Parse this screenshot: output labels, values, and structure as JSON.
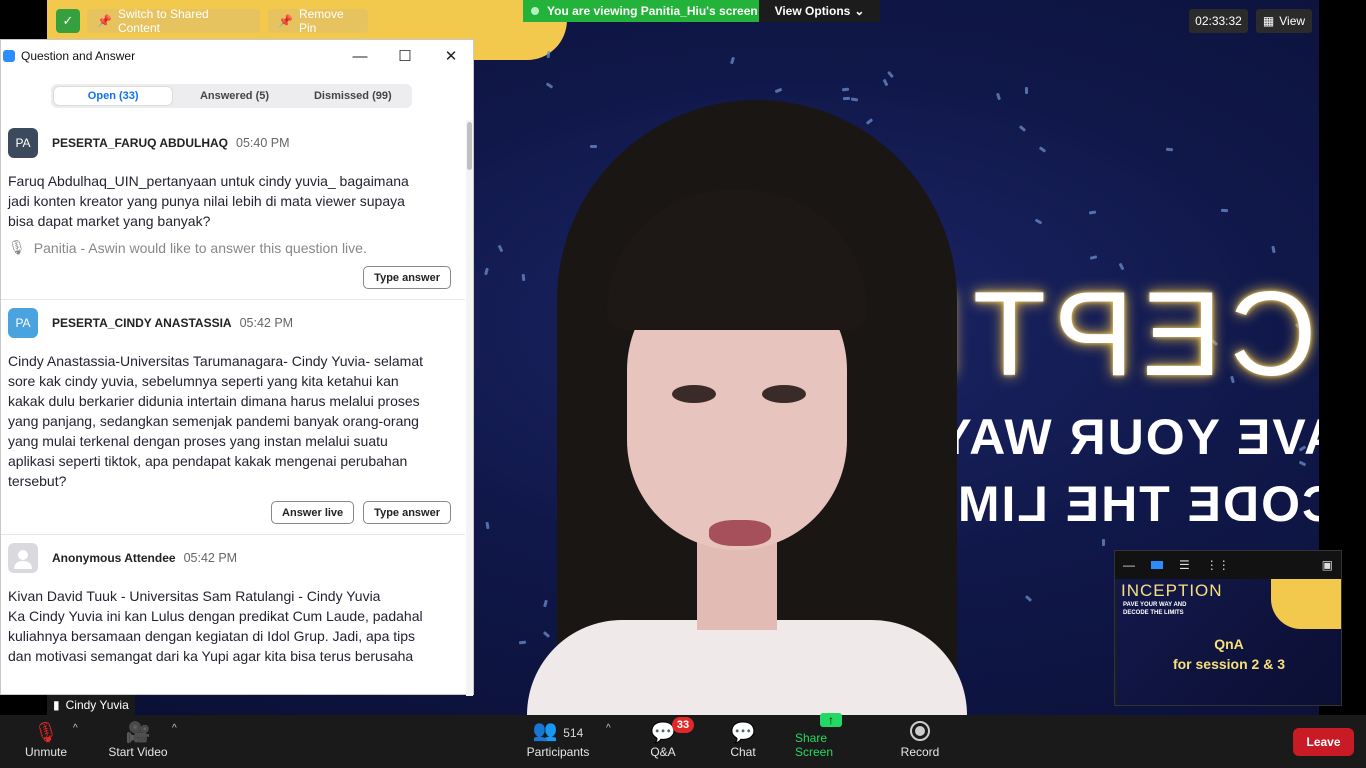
{
  "top_bar": {
    "switch_label": "Switch to Shared Content",
    "remove_pin_label": "Remove Pin",
    "viewing_label": "You are viewing Panitia_Hiu's screen",
    "view_options_label": "View Options",
    "timer": "02:33:32",
    "view_label": "View"
  },
  "video": {
    "inception_text": "INCEPTIO",
    "pave_text": "PAVE YOUR WAY AN",
    "decode_text": "DECODE THE LIMITS",
    "speaker_name": "Cindy Yuvia"
  },
  "qa_window": {
    "title": "Question and Answer",
    "tabs": [
      {
        "label": "Open (33)",
        "active": true
      },
      {
        "label": "Answered (5)",
        "active": false
      },
      {
        "label": "Dismissed (99)",
        "active": false
      }
    ],
    "questions": [
      {
        "avatar": "PA",
        "avatar_color": "#3b4a5c",
        "name": "PESERTA_FARUQ ABDULHAQ",
        "time": "05:40 PM",
        "text": "Faruq Abdulhaq_UIN_pertanyaan untuk cindy yuvia_ bagaimana\n jadi konten kreator yang punya nilai lebih di mata viewer supaya\nbisa dapat market yang banyak?",
        "live_note": "Panitia - Aswin would like to answer this question live.",
        "buttons": [
          "Type answer"
        ]
      },
      {
        "avatar": "PA",
        "avatar_color": "#4aa3df",
        "name": "PESERTA_CINDY ANASTASSIA",
        "time": "05:42 PM",
        "text": "Cindy Anastassia-Universitas Tarumanagara- Cindy Yuvia- selamat\nsore kak cindy yuvia, sebelumnya seperti yang kita ketahui kan\nkakak dulu berkarier didunia intertain dimana harus melalui proses\nyang panjang, sedangkan semenjak pandemi banyak orang-orang\nyang mulai terkenal dengan proses yang instan melalui suatu\naplikasi seperti tiktok, apa pendapat kakak mengenai perubahan\ntersebut?",
        "buttons": [
          "Answer live",
          "Type answer"
        ]
      },
      {
        "avatar": "",
        "avatar_color": "#d9d9de",
        "name": "Anonymous Attendee",
        "time": "05:42 PM",
        "text": "Kivan David Tuuk - Universitas Sam Ratulangi - Cindy Yuvia\nKa Cindy Yuvia ini kan Lulus dengan predikat Cum Laude, padahal\nkuliahnya bersamaan dengan kegiatan di Idol Grup. Jadi, apa tips\ndan motivasi semangat dari ka Yupi agar kita bisa terus berusaha",
        "buttons": []
      }
    ]
  },
  "mini_video": {
    "inception": "INCEPTION",
    "pave": "PAVE YOUR WAY AND DECODE THE LIMITS",
    "qna_line1": "QnA",
    "qna_line2": "for session 2 & 3"
  },
  "toolbar": {
    "unmute": "Unmute",
    "start_video": "Start Video",
    "participants": "Participants",
    "participants_count": "514",
    "qa": "Q&A",
    "qa_badge": "33",
    "chat": "Chat",
    "share_screen": "Share Screen",
    "record": "Record",
    "leave": "Leave"
  },
  "colors": {
    "share_green": "#23d964",
    "leave_red": "#c91b25",
    "tab_active_blue": "#0e72ed"
  }
}
